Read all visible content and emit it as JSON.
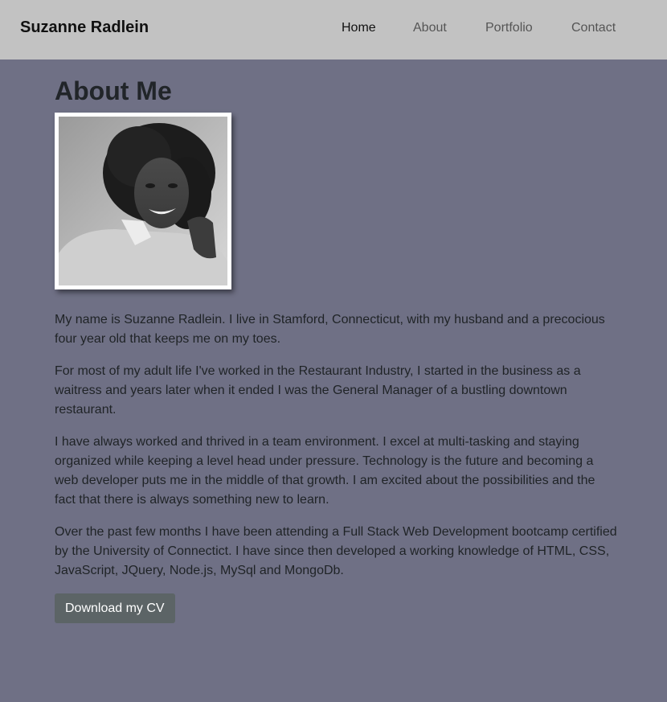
{
  "navbar": {
    "brand": "Suzanne Radlein",
    "links": [
      "Home",
      "About",
      "Portfolio",
      "Contact"
    ]
  },
  "about": {
    "title": "About Me",
    "photo_alt": "Portrait photo of Suzanne Radlein",
    "paragraphs": [
      "My name is Suzanne Radlein. I live in Stamford, Connecticut, with my husband and a precocious four year old that keeps me on my toes.",
      "For most of my adult life I've worked in the Restaurant Industry, I started in the business as a waitress and years later when it ended I was the General Manager of a bustling downtown restaurant.",
      "I have always worked and thrived in a team environment. I excel at multi-tasking and staying organized while keeping a level head under pressure. Technology is the future and becoming a web developer puts me in the middle of that growth. I am excited about the possibilities and the fact that there is always something new to learn.",
      "Over the past few months I have been attending a Full Stack Web Development bootcamp certified by the University of Connectict. I have since then developed a working knowledge of HTML, CSS, JavaScript, JQuery, Node.js, MySql and MongoDb."
    ],
    "cv_button": "Download my CV"
  },
  "colors": {
    "navbar_bg": "#c2c2c2",
    "page_bg": "#6f7085",
    "button_bg": "#5c6466"
  }
}
